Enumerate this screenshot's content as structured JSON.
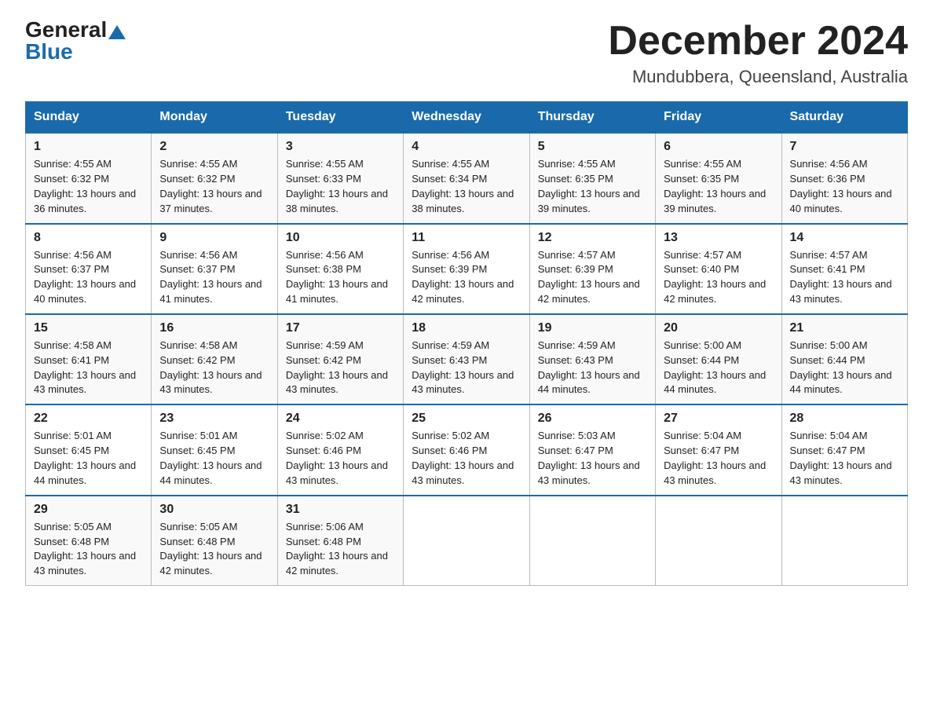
{
  "header": {
    "logo_general": "General",
    "logo_blue": "Blue",
    "month": "December 2024",
    "location": "Mundubbera, Queensland, Australia"
  },
  "days_of_week": [
    "Sunday",
    "Monday",
    "Tuesday",
    "Wednesday",
    "Thursday",
    "Friday",
    "Saturday"
  ],
  "weeks": [
    [
      {
        "day": "1",
        "sunrise": "4:55 AM",
        "sunset": "6:32 PM",
        "daylight": "13 hours and 36 minutes."
      },
      {
        "day": "2",
        "sunrise": "4:55 AM",
        "sunset": "6:32 PM",
        "daylight": "13 hours and 37 minutes."
      },
      {
        "day": "3",
        "sunrise": "4:55 AM",
        "sunset": "6:33 PM",
        "daylight": "13 hours and 38 minutes."
      },
      {
        "day": "4",
        "sunrise": "4:55 AM",
        "sunset": "6:34 PM",
        "daylight": "13 hours and 38 minutes."
      },
      {
        "day": "5",
        "sunrise": "4:55 AM",
        "sunset": "6:35 PM",
        "daylight": "13 hours and 39 minutes."
      },
      {
        "day": "6",
        "sunrise": "4:55 AM",
        "sunset": "6:35 PM",
        "daylight": "13 hours and 39 minutes."
      },
      {
        "day": "7",
        "sunrise": "4:56 AM",
        "sunset": "6:36 PM",
        "daylight": "13 hours and 40 minutes."
      }
    ],
    [
      {
        "day": "8",
        "sunrise": "4:56 AM",
        "sunset": "6:37 PM",
        "daylight": "13 hours and 40 minutes."
      },
      {
        "day": "9",
        "sunrise": "4:56 AM",
        "sunset": "6:37 PM",
        "daylight": "13 hours and 41 minutes."
      },
      {
        "day": "10",
        "sunrise": "4:56 AM",
        "sunset": "6:38 PM",
        "daylight": "13 hours and 41 minutes."
      },
      {
        "day": "11",
        "sunrise": "4:56 AM",
        "sunset": "6:39 PM",
        "daylight": "13 hours and 42 minutes."
      },
      {
        "day": "12",
        "sunrise": "4:57 AM",
        "sunset": "6:39 PM",
        "daylight": "13 hours and 42 minutes."
      },
      {
        "day": "13",
        "sunrise": "4:57 AM",
        "sunset": "6:40 PM",
        "daylight": "13 hours and 42 minutes."
      },
      {
        "day": "14",
        "sunrise": "4:57 AM",
        "sunset": "6:41 PM",
        "daylight": "13 hours and 43 minutes."
      }
    ],
    [
      {
        "day": "15",
        "sunrise": "4:58 AM",
        "sunset": "6:41 PM",
        "daylight": "13 hours and 43 minutes."
      },
      {
        "day": "16",
        "sunrise": "4:58 AM",
        "sunset": "6:42 PM",
        "daylight": "13 hours and 43 minutes."
      },
      {
        "day": "17",
        "sunrise": "4:59 AM",
        "sunset": "6:42 PM",
        "daylight": "13 hours and 43 minutes."
      },
      {
        "day": "18",
        "sunrise": "4:59 AM",
        "sunset": "6:43 PM",
        "daylight": "13 hours and 43 minutes."
      },
      {
        "day": "19",
        "sunrise": "4:59 AM",
        "sunset": "6:43 PM",
        "daylight": "13 hours and 44 minutes."
      },
      {
        "day": "20",
        "sunrise": "5:00 AM",
        "sunset": "6:44 PM",
        "daylight": "13 hours and 44 minutes."
      },
      {
        "day": "21",
        "sunrise": "5:00 AM",
        "sunset": "6:44 PM",
        "daylight": "13 hours and 44 minutes."
      }
    ],
    [
      {
        "day": "22",
        "sunrise": "5:01 AM",
        "sunset": "6:45 PM",
        "daylight": "13 hours and 44 minutes."
      },
      {
        "day": "23",
        "sunrise": "5:01 AM",
        "sunset": "6:45 PM",
        "daylight": "13 hours and 44 minutes."
      },
      {
        "day": "24",
        "sunrise": "5:02 AM",
        "sunset": "6:46 PM",
        "daylight": "13 hours and 43 minutes."
      },
      {
        "day": "25",
        "sunrise": "5:02 AM",
        "sunset": "6:46 PM",
        "daylight": "13 hours and 43 minutes."
      },
      {
        "day": "26",
        "sunrise": "5:03 AM",
        "sunset": "6:47 PM",
        "daylight": "13 hours and 43 minutes."
      },
      {
        "day": "27",
        "sunrise": "5:04 AM",
        "sunset": "6:47 PM",
        "daylight": "13 hours and 43 minutes."
      },
      {
        "day": "28",
        "sunrise": "5:04 AM",
        "sunset": "6:47 PM",
        "daylight": "13 hours and 43 minutes."
      }
    ],
    [
      {
        "day": "29",
        "sunrise": "5:05 AM",
        "sunset": "6:48 PM",
        "daylight": "13 hours and 43 minutes."
      },
      {
        "day": "30",
        "sunrise": "5:05 AM",
        "sunset": "6:48 PM",
        "daylight": "13 hours and 42 minutes."
      },
      {
        "day": "31",
        "sunrise": "5:06 AM",
        "sunset": "6:48 PM",
        "daylight": "13 hours and 42 minutes."
      },
      null,
      null,
      null,
      null
    ]
  ]
}
